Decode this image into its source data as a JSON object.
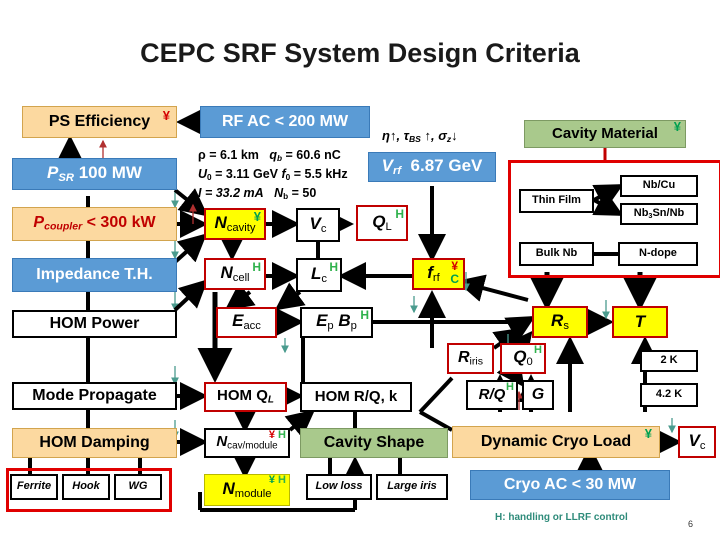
{
  "slide": {
    "title": "CEPC SRF System Design Criteria",
    "footnote": "H: handling or LLRF control",
    "page_number": "6"
  },
  "markers": {
    "yen": "¥",
    "h": "H",
    "c": "C"
  },
  "colors": {
    "blue_fill": "#5b9bd5",
    "orange_fill": "#fcd9a0",
    "yellow_fill": "#ffff00",
    "green_fill": "#a9c98c",
    "red_border": "#c00000",
    "red_group": "#e00000",
    "teal_text": "#2e8b7a",
    "yen_red": "#d40000",
    "marker_green": "#2fb24c"
  },
  "boxes": {
    "ps_efficiency": "PS Efficiency",
    "rf_ac": "RF AC < 200 MW",
    "p_sr": "P",
    "p_sr_sub": "SR",
    "p_sr_val": "100 MW",
    "p_coupler": "P",
    "p_coupler_sub": "coupler",
    "p_coupler_val": "< 300 kW",
    "impedance": "Impedance T.H.",
    "hom_power": "HOM Power",
    "mode_propagate": "Mode Propagate",
    "hom_damping": "HOM Damping",
    "ferrite": "Ferrite",
    "hook": "Hook",
    "wg": "WG",
    "n_cavity": "N",
    "n_cavity_sub": "cavity",
    "n_cell": "N",
    "n_cell_sub": "cell",
    "e_acc": "E",
    "e_acc_sub": "acc",
    "hom_ql": "HOM  Q",
    "hom_ql_sub": "L",
    "n_cav_module": "N",
    "n_cav_module_sub": "cav/module",
    "n_module": "N",
    "n_module_sub": "module",
    "v_c": "V",
    "v_c_sub": "c",
    "l_c": "L",
    "l_c_sub": "c",
    "e_p": "E",
    "e_p_sub": "p",
    "b_p": "B",
    "b_p_sub": "p",
    "hom_rq_k": "HOM R/Q, k",
    "cavity_shape": "Cavity Shape",
    "low_loss": "Low loss",
    "large_iris": "Large iris",
    "q_l": "Q",
    "q_l_sub": "L",
    "f_rf": "f",
    "f_rf_sub": "rf",
    "r_iris": "R",
    "r_iris_sub": "iris",
    "q0": "Q",
    "q0_sub": "0",
    "r_over_q": "R/Q",
    "g": "G",
    "dynamic_cryo_load": "Dynamic Cryo Load",
    "cryo_ac": "Cryo AC < 30 MW",
    "v_c_right": "V",
    "v_c_right_sub": "c",
    "r_s": "R",
    "r_s_sub": "s",
    "temp_t": "T",
    "two_k": "2 K",
    "four_two_k": "4.2 K",
    "cavity_material": "Cavity Material",
    "thin_film": "Thin Film",
    "bulk_nb": "Bulk Nb",
    "nb_cu": "Nb/Cu",
    "nb3sn_nb_a": "Nb",
    "nb3sn_nb_sub": "3",
    "nb3sn_nb_b": "Sn/Nb",
    "n_dope": "N-dope",
    "v_rf": "V",
    "v_rf_sub": "rf",
    "v_rf_val": "6.87 GeV"
  },
  "annotations": {
    "eta_line": "η↑, τ",
    "eta_sub": "BS",
    "eta_line2": " ↑, σ",
    "eta_sub2": "z",
    "eta_line3": "↓"
  },
  "parameters": {
    "line1_a": "ρ = 6.1 km",
    "line1_b": "q",
    "line1_b_sub": "b",
    "line1_c": " = 60.6 nC",
    "line2_a": "U",
    "line2_a_sub": "0",
    "line2_b": " = 3.11 GeV",
    "line2_c": "f",
    "line2_c_sub": "0",
    "line2_d": " = 5.5 kHz",
    "line3_a": "I = 33.2 mA",
    "line3_b": "N",
    "line3_b_sub": "b",
    "line3_c": " = 50"
  }
}
